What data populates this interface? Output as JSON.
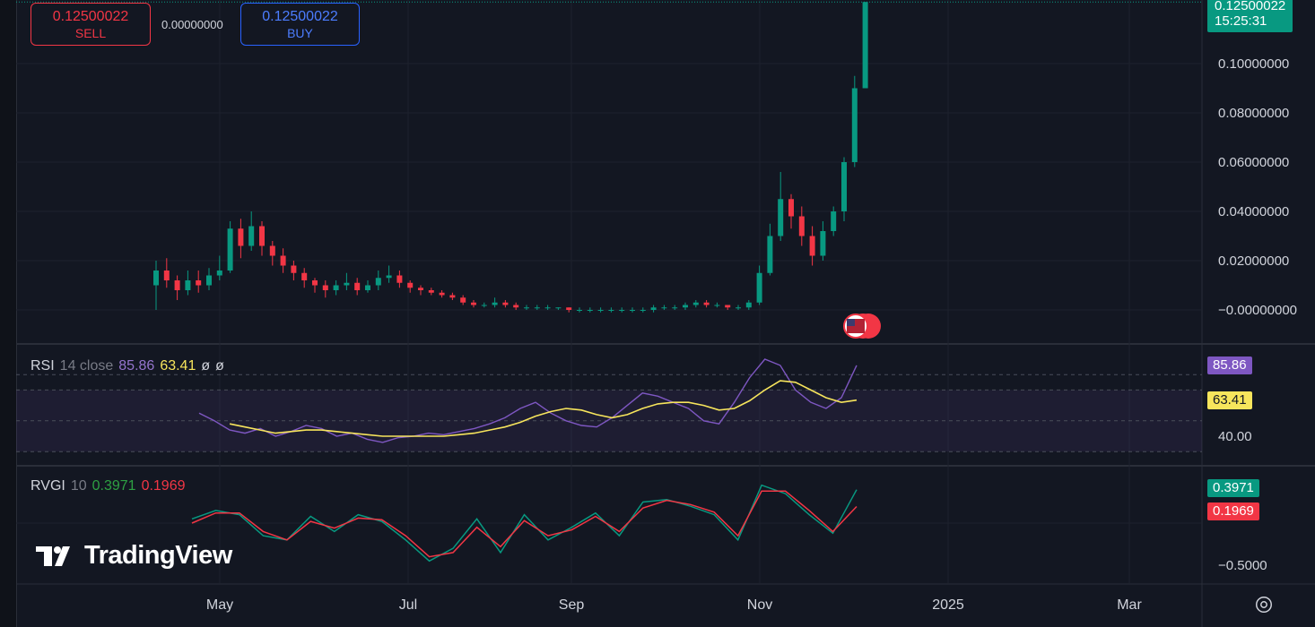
{
  "trade": {
    "sell_price": "0.12500022",
    "sell_label": "SELL",
    "spread": "0.00000000",
    "buy_price": "0.12500022",
    "buy_label": "BUY"
  },
  "last_price": {
    "value": "0.12500022",
    "countdown": "15:25:31"
  },
  "price_axis": {
    "ticks": [
      "0.10000000",
      "0.08000000",
      "0.06000000",
      "0.04000000",
      "0.02000000",
      "−0.00000000"
    ]
  },
  "time_axis": {
    "labels": [
      "May",
      "Jul",
      "Sep",
      "Nov",
      "2025",
      "Mar"
    ]
  },
  "rsi": {
    "name": "RSI",
    "params": "14 close",
    "value": "85.86",
    "ma_value": "63.41",
    "empty1": "ø",
    "empty2": "ø",
    "axis_label": "40.00"
  },
  "rvgi": {
    "name": "RVGI",
    "params": "10",
    "value": "0.3971",
    "signal": "0.1969",
    "axis_label": "−0.5000"
  },
  "brand": {
    "name": "TradingView"
  },
  "colors": {
    "up": "#089981",
    "down": "#f23645",
    "rsi_line": "#7e57c2",
    "rsi_ma": "#f7e55c",
    "rvgi_line": "#089981",
    "rvgi_signal": "#f23645",
    "last_price_tag": "#089981"
  },
  "chart_data": [
    {
      "type": "candlestick",
      "title": "",
      "x_labels": [
        "May",
        "Jul",
        "Sep",
        "Nov",
        "2025",
        "Mar"
      ],
      "ylim": [
        -0.006,
        0.125
      ],
      "y_ticks": [
        0.1,
        0.08,
        0.06,
        0.04,
        0.02,
        0.0
      ],
      "last": 0.12500022,
      "series": [
        {
          "t": 0,
          "o": 0.01,
          "c": 0.016,
          "h": 0.02,
          "l": 0.0
        },
        {
          "t": 1,
          "o": 0.016,
          "c": 0.012,
          "h": 0.021,
          "l": 0.009
        },
        {
          "t": 2,
          "o": 0.012,
          "c": 0.008,
          "h": 0.014,
          "l": 0.004
        },
        {
          "t": 3,
          "o": 0.008,
          "c": 0.012,
          "h": 0.016,
          "l": 0.006
        },
        {
          "t": 4,
          "o": 0.012,
          "c": 0.01,
          "h": 0.016,
          "l": 0.007
        },
        {
          "t": 5,
          "o": 0.01,
          "c": 0.014,
          "h": 0.017,
          "l": 0.008
        },
        {
          "t": 6,
          "o": 0.014,
          "c": 0.016,
          "h": 0.022,
          "l": 0.012
        },
        {
          "t": 7,
          "o": 0.016,
          "c": 0.033,
          "h": 0.036,
          "l": 0.015
        },
        {
          "t": 8,
          "o": 0.033,
          "c": 0.026,
          "h": 0.037,
          "l": 0.021
        },
        {
          "t": 9,
          "o": 0.026,
          "c": 0.034,
          "h": 0.04,
          "l": 0.024
        },
        {
          "t": 10,
          "o": 0.034,
          "c": 0.026,
          "h": 0.036,
          "l": 0.022
        },
        {
          "t": 11,
          "o": 0.026,
          "c": 0.022,
          "h": 0.028,
          "l": 0.018
        },
        {
          "t": 12,
          "o": 0.022,
          "c": 0.018,
          "h": 0.025,
          "l": 0.015
        },
        {
          "t": 13,
          "o": 0.018,
          "c": 0.015,
          "h": 0.02,
          "l": 0.012
        },
        {
          "t": 14,
          "o": 0.015,
          "c": 0.012,
          "h": 0.017,
          "l": 0.009
        },
        {
          "t": 15,
          "o": 0.012,
          "c": 0.01,
          "h": 0.013,
          "l": 0.007
        },
        {
          "t": 16,
          "o": 0.01,
          "c": 0.008,
          "h": 0.012,
          "l": 0.005
        },
        {
          "t": 17,
          "o": 0.008,
          "c": 0.01,
          "h": 0.012,
          "l": 0.006
        },
        {
          "t": 18,
          "o": 0.01,
          "c": 0.011,
          "h": 0.015,
          "l": 0.008
        },
        {
          "t": 19,
          "o": 0.011,
          "c": 0.008,
          "h": 0.013,
          "l": 0.006
        },
        {
          "t": 20,
          "o": 0.008,
          "c": 0.01,
          "h": 0.012,
          "l": 0.007
        },
        {
          "t": 21,
          "o": 0.01,
          "c": 0.013,
          "h": 0.016,
          "l": 0.008
        },
        {
          "t": 22,
          "o": 0.013,
          "c": 0.014,
          "h": 0.018,
          "l": 0.011
        },
        {
          "t": 23,
          "o": 0.014,
          "c": 0.011,
          "h": 0.016,
          "l": 0.009
        },
        {
          "t": 24,
          "o": 0.011,
          "c": 0.009,
          "h": 0.012,
          "l": 0.007
        },
        {
          "t": 25,
          "o": 0.009,
          "c": 0.008,
          "h": 0.01,
          "l": 0.006
        },
        {
          "t": 26,
          "o": 0.008,
          "c": 0.007,
          "h": 0.009,
          "l": 0.006
        },
        {
          "t": 27,
          "o": 0.007,
          "c": 0.006,
          "h": 0.008,
          "l": 0.005
        },
        {
          "t": 28,
          "o": 0.006,
          "c": 0.005,
          "h": 0.007,
          "l": 0.004
        },
        {
          "t": 29,
          "o": 0.005,
          "c": 0.003,
          "h": 0.006,
          "l": 0.002
        },
        {
          "t": 30,
          "o": 0.003,
          "c": 0.002,
          "h": 0.004,
          "l": 0.001
        },
        {
          "t": 31,
          "o": 0.002,
          "c": 0.002,
          "h": 0.003,
          "l": 0.001
        },
        {
          "t": 32,
          "o": 0.002,
          "c": 0.003,
          "h": 0.005,
          "l": 0.001
        },
        {
          "t": 33,
          "o": 0.003,
          "c": 0.002,
          "h": 0.004,
          "l": 0.001
        },
        {
          "t": 34,
          "o": 0.002,
          "c": 0.001,
          "h": 0.003,
          "l": 0.0
        },
        {
          "t": 35,
          "o": 0.001,
          "c": 0.001,
          "h": 0.002,
          "l": 0.0
        },
        {
          "t": 36,
          "o": 0.001,
          "c": 0.001,
          "h": 0.002,
          "l": 0.0
        },
        {
          "t": 37,
          "o": 0.001,
          "c": 0.001,
          "h": 0.002,
          "l": 0.0
        },
        {
          "t": 38,
          "o": 0.001,
          "c": 0.001,
          "h": 0.001,
          "l": 0.0
        },
        {
          "t": 39,
          "o": 0.001,
          "c": 0.0,
          "h": 0.001,
          "l": -0.001
        },
        {
          "t": 40,
          "o": 0.0,
          "c": 0.0,
          "h": 0.001,
          "l": -0.001
        },
        {
          "t": 41,
          "o": 0.0,
          "c": 0.0,
          "h": 0.001,
          "l": -0.001
        },
        {
          "t": 42,
          "o": 0.0,
          "c": 0.0,
          "h": 0.001,
          "l": -0.001
        },
        {
          "t": 43,
          "o": 0.0,
          "c": 0.0,
          "h": 0.001,
          "l": -0.001
        },
        {
          "t": 44,
          "o": 0.0,
          "c": 0.0,
          "h": 0.001,
          "l": -0.001
        },
        {
          "t": 45,
          "o": 0.0,
          "c": 0.0,
          "h": 0.001,
          "l": -0.001
        },
        {
          "t": 46,
          "o": 0.0,
          "c": 0.0,
          "h": 0.001,
          "l": -0.001
        },
        {
          "t": 47,
          "o": 0.0,
          "c": 0.001,
          "h": 0.002,
          "l": -0.001
        },
        {
          "t": 48,
          "o": 0.001,
          "c": 0.001,
          "h": 0.002,
          "l": 0.0
        },
        {
          "t": 49,
          "o": 0.001,
          "c": 0.001,
          "h": 0.002,
          "l": 0.0
        },
        {
          "t": 50,
          "o": 0.001,
          "c": 0.002,
          "h": 0.003,
          "l": 0.0
        },
        {
          "t": 51,
          "o": 0.002,
          "c": 0.003,
          "h": 0.004,
          "l": 0.001
        },
        {
          "t": 52,
          "o": 0.003,
          "c": 0.002,
          "h": 0.004,
          "l": 0.001
        },
        {
          "t": 53,
          "o": 0.002,
          "c": 0.002,
          "h": 0.003,
          "l": 0.001
        },
        {
          "t": 54,
          "o": 0.002,
          "c": 0.001,
          "h": 0.002,
          "l": 0.0
        },
        {
          "t": 55,
          "o": 0.001,
          "c": 0.001,
          "h": 0.002,
          "l": 0.0
        },
        {
          "t": 56,
          "o": 0.001,
          "c": 0.003,
          "h": 0.004,
          "l": 0.0
        },
        {
          "t": 57,
          "o": 0.003,
          "c": 0.015,
          "h": 0.018,
          "l": 0.002
        },
        {
          "t": 58,
          "o": 0.015,
          "c": 0.03,
          "h": 0.035,
          "l": 0.014
        },
        {
          "t": 59,
          "o": 0.03,
          "c": 0.045,
          "h": 0.056,
          "l": 0.028
        },
        {
          "t": 60,
          "o": 0.045,
          "c": 0.038,
          "h": 0.047,
          "l": 0.033
        },
        {
          "t": 61,
          "o": 0.038,
          "c": 0.03,
          "h": 0.042,
          "l": 0.026
        },
        {
          "t": 62,
          "o": 0.03,
          "c": 0.022,
          "h": 0.034,
          "l": 0.018
        },
        {
          "t": 63,
          "o": 0.022,
          "c": 0.032,
          "h": 0.036,
          "l": 0.02
        },
        {
          "t": 64,
          "o": 0.032,
          "c": 0.04,
          "h": 0.042,
          "l": 0.03
        },
        {
          "t": 65,
          "o": 0.04,
          "c": 0.06,
          "h": 0.062,
          "l": 0.036
        },
        {
          "t": 66,
          "o": 0.06,
          "c": 0.09,
          "h": 0.095,
          "l": 0.058
        },
        {
          "t": 67,
          "o": 0.09,
          "c": 0.125,
          "h": 0.125,
          "l": 0.09
        }
      ]
    },
    {
      "type": "line",
      "title": "RSI 14 close",
      "ylim": [
        30,
        90
      ],
      "y_ticks": [
        40
      ],
      "series": [
        {
          "name": "RSI",
          "values": [
            55,
            50,
            44,
            42,
            45,
            40,
            43,
            47,
            45,
            40,
            42,
            38,
            36,
            39,
            40,
            42,
            41,
            43,
            45,
            48,
            52,
            58,
            62,
            55,
            50,
            47,
            46,
            52,
            60,
            68,
            66,
            62,
            58,
            50,
            48,
            62,
            78,
            90,
            86,
            70,
            62,
            58,
            65,
            86
          ]
        },
        {
          "name": "RSI MA",
          "values": [
            null,
            null,
            48,
            46,
            44,
            42,
            43,
            44,
            44,
            43,
            42,
            41,
            40,
            40,
            40,
            40,
            40,
            41,
            42,
            44,
            46,
            49,
            53,
            56,
            58,
            57,
            54,
            52,
            54,
            58,
            61,
            62,
            62,
            60,
            57,
            58,
            63,
            70,
            76,
            75,
            70,
            65,
            62,
            63.41
          ]
        }
      ]
    },
    {
      "type": "line",
      "title": "RVGI 10",
      "ylim": [
        -0.62,
        0.55
      ],
      "y_ticks": [
        -0.5
      ],
      "series": [
        {
          "name": "RVGI",
          "values": [
            0.05,
            0.15,
            0.1,
            -0.15,
            -0.2,
            0.08,
            -0.1,
            0.1,
            0.02,
            -0.2,
            -0.45,
            -0.3,
            0.05,
            -0.35,
            0.1,
            -0.2,
            -0.05,
            0.12,
            -0.15,
            0.25,
            0.28,
            0.2,
            0.1,
            -0.2,
            0.45,
            0.35,
            0.1,
            -0.12,
            0.3971
          ]
        },
        {
          "name": "Signal",
          "values": [
            0.0,
            0.12,
            0.12,
            -0.1,
            -0.2,
            0.02,
            -0.06,
            0.06,
            0.04,
            -0.15,
            -0.4,
            -0.35,
            -0.05,
            -0.28,
            0.03,
            -0.15,
            -0.08,
            0.08,
            -0.1,
            0.18,
            0.27,
            0.22,
            0.13,
            -0.15,
            0.38,
            0.38,
            0.15,
            -0.1,
            0.1969
          ]
        }
      ]
    }
  ]
}
